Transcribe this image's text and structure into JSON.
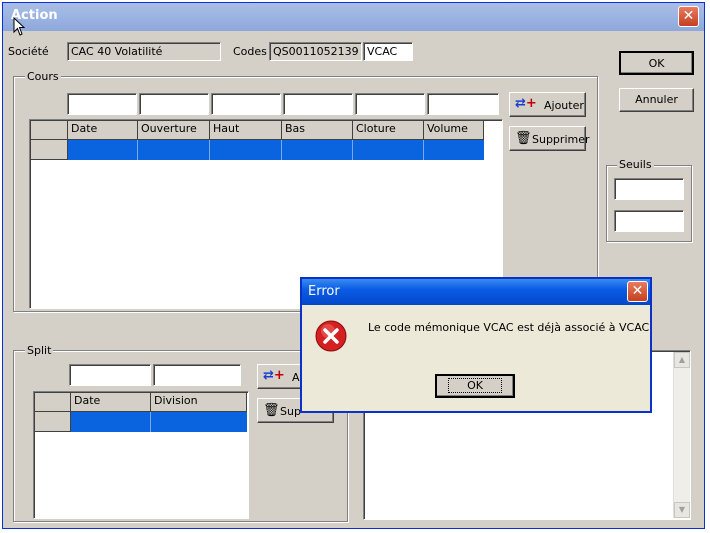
{
  "window": {
    "title": "Action"
  },
  "header": {
    "societe_label": "Société",
    "societe_value": "CAC 40 Volatilité",
    "codes_label": "Codes",
    "code_isin": "QS0011052139",
    "code_mnemo": "VCAC"
  },
  "buttons": {
    "ok": "OK",
    "annuler": "Annuler"
  },
  "cours": {
    "label": "Cours",
    "add_label": "Ajouter",
    "delete_label": "Supprimer",
    "columns": [
      "Date",
      "Ouverture",
      "Haut",
      "Bas",
      "Cloture",
      "Volume"
    ]
  },
  "seuils": {
    "label": "Seuils"
  },
  "split": {
    "label": "Split",
    "add_label": "A",
    "delete_label": "Sup",
    "columns": [
      "Date",
      "Division"
    ]
  },
  "error_dialog": {
    "title": "Error",
    "message": "Le code mémonique VCAC est déjà associé à VCAC",
    "ok_label": "OK"
  },
  "colors": {
    "titlebar_inactive": "#9eb6e3",
    "titlebar_active": "#0a5ce6",
    "selection": "#0a64e0"
  }
}
